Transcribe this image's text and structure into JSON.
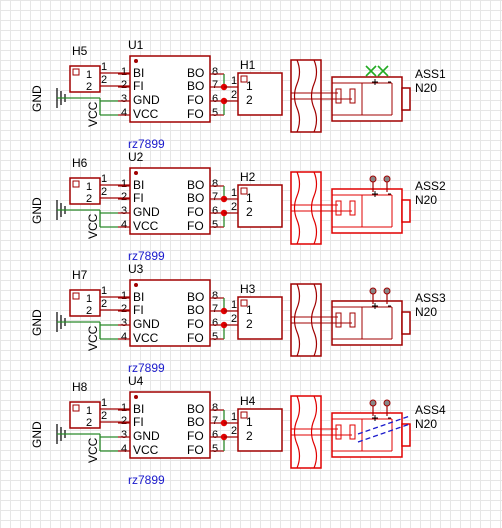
{
  "schematic": {
    "net_gnd": "GND",
    "net_vcc": "VCC",
    "headers": [
      "H5",
      "H6",
      "H7",
      "H8"
    ],
    "chips": [
      {
        "ref": "U1",
        "part": "rz7899",
        "out": "H1",
        "motor": "ASS1",
        "motor_sub": "N20",
        "color": "#1a1acc"
      },
      {
        "ref": "U2",
        "part": "rz7899",
        "out": "H2",
        "motor": "ASS2",
        "motor_sub": "N20",
        "color": "#e00000"
      },
      {
        "ref": "U3",
        "part": "rz7899",
        "out": "H3",
        "motor": "ASS3",
        "motor_sub": "N20",
        "color": "#1a1acc"
      },
      {
        "ref": "U4",
        "part": "rz7899",
        "out": "H4",
        "motor": "ASS4",
        "motor_sub": "N20",
        "color": "#e00000"
      }
    ],
    "pins_left": [
      "BI",
      "FI",
      "GND",
      "VCC"
    ],
    "pins_right": [
      "BO",
      "BO",
      "FO",
      "FO"
    ],
    "pin_nums_left": [
      "1",
      "2",
      "3",
      "4"
    ],
    "pin_nums_right": [
      "8",
      "7",
      "6",
      "5"
    ],
    "header_pins": [
      "1",
      "2"
    ]
  }
}
